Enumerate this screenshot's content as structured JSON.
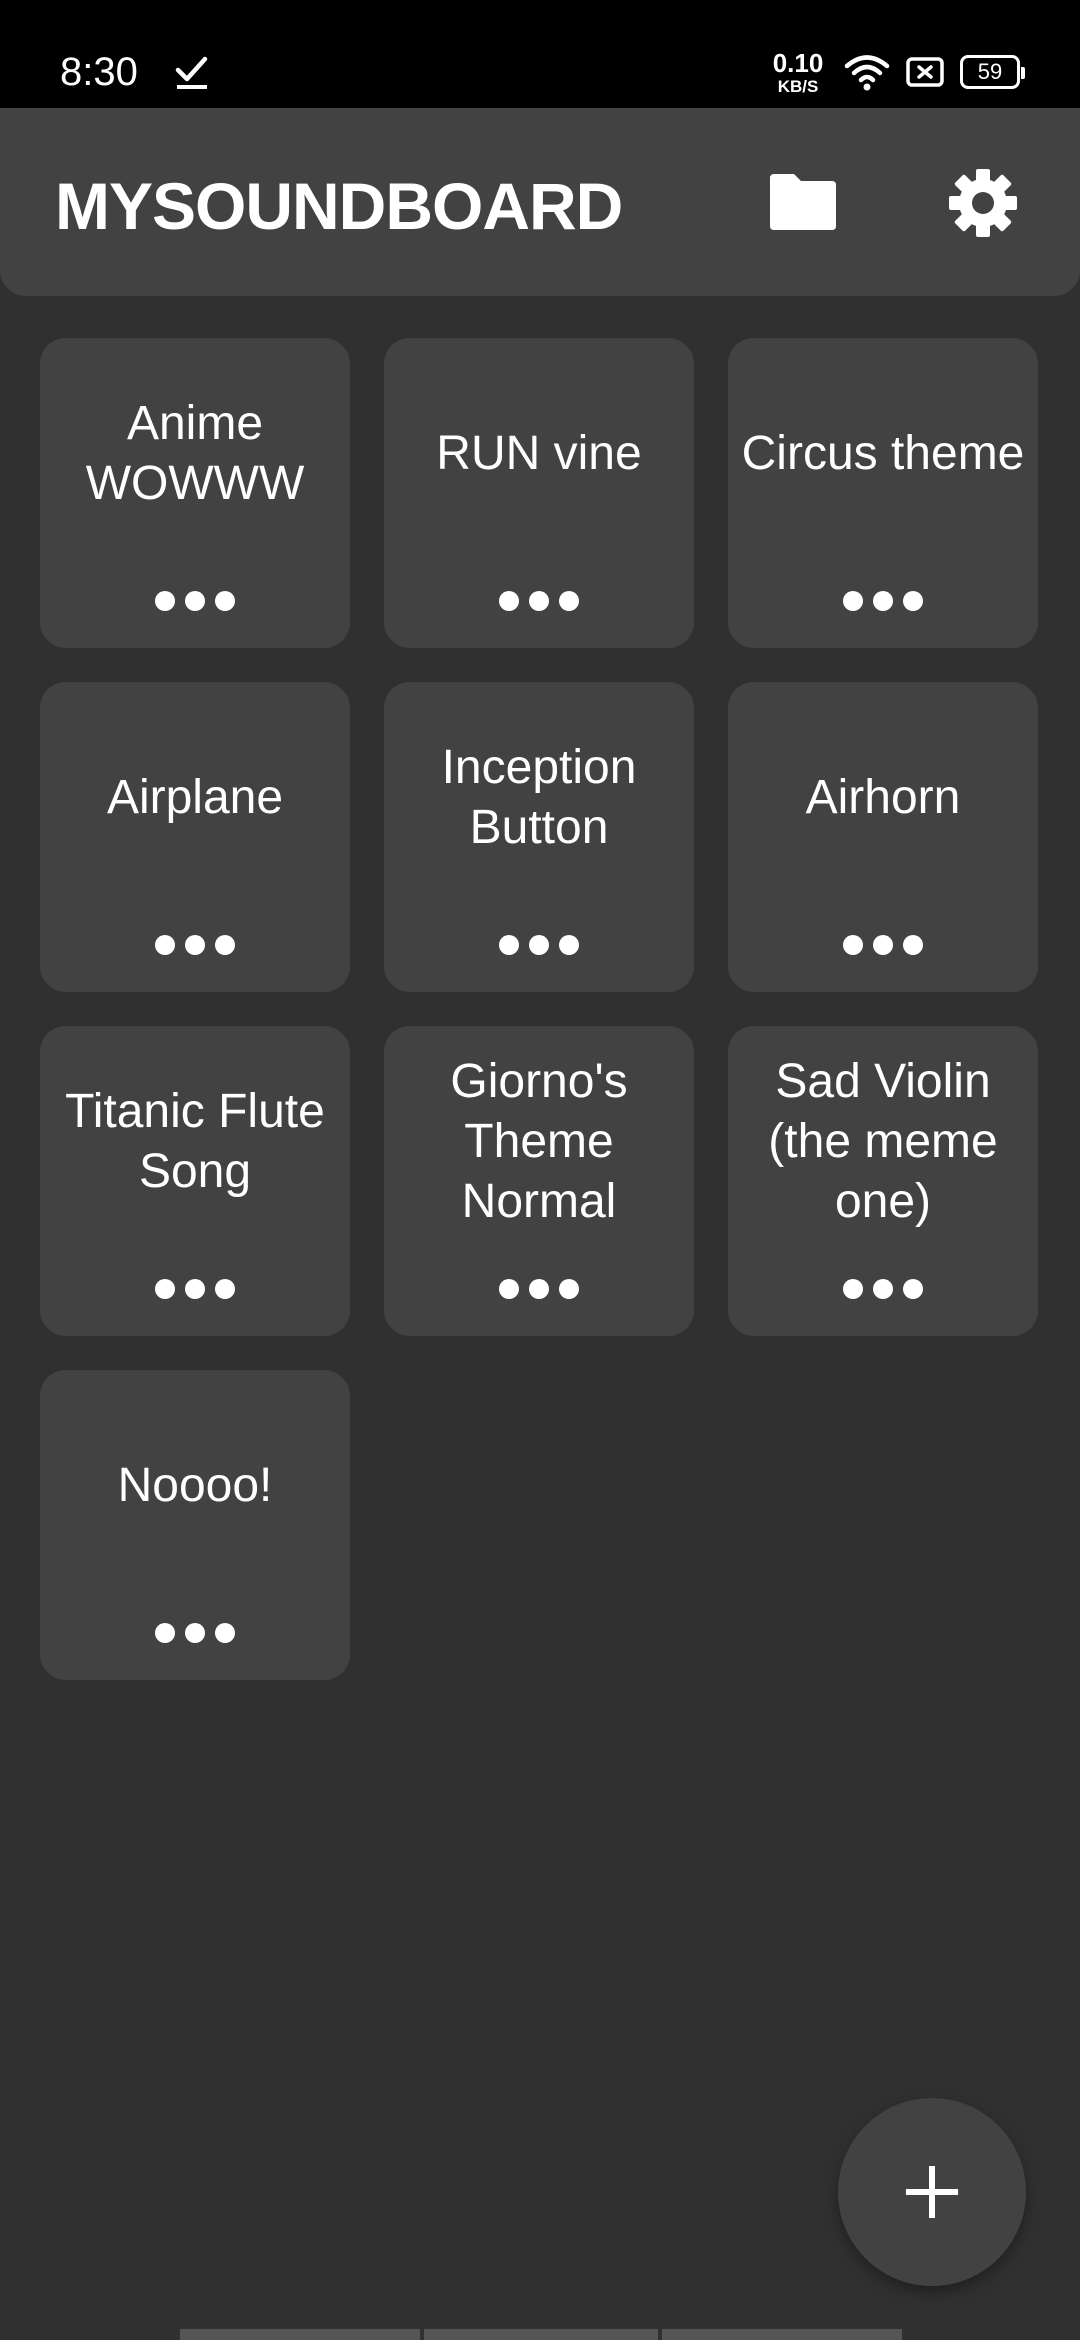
{
  "status_bar": {
    "time": "8:30",
    "net_speed_value": "0.10",
    "net_speed_unit": "KB/S",
    "battery": "59"
  },
  "app_bar": {
    "title": "MYSOUNDBOARD",
    "folder_icon": "folder-icon",
    "settings_icon": "gear-icon"
  },
  "sounds": [
    {
      "label": "Anime WOWWW"
    },
    {
      "label": "RUN vine"
    },
    {
      "label": "Circus theme"
    },
    {
      "label": "Airplane"
    },
    {
      "label": "Inception Button"
    },
    {
      "label": "Airhorn"
    },
    {
      "label": "Titanic Flute Song"
    },
    {
      "label": "Giorno's Theme Normal"
    },
    {
      "label": "Sad Violin (the meme one)"
    },
    {
      "label": "Noooo!"
    }
  ],
  "fab": {
    "icon": "plus-icon"
  },
  "colors": {
    "background": "#303030",
    "surface": "#424242",
    "text": "#ffffff",
    "status_bar": "#000000"
  }
}
